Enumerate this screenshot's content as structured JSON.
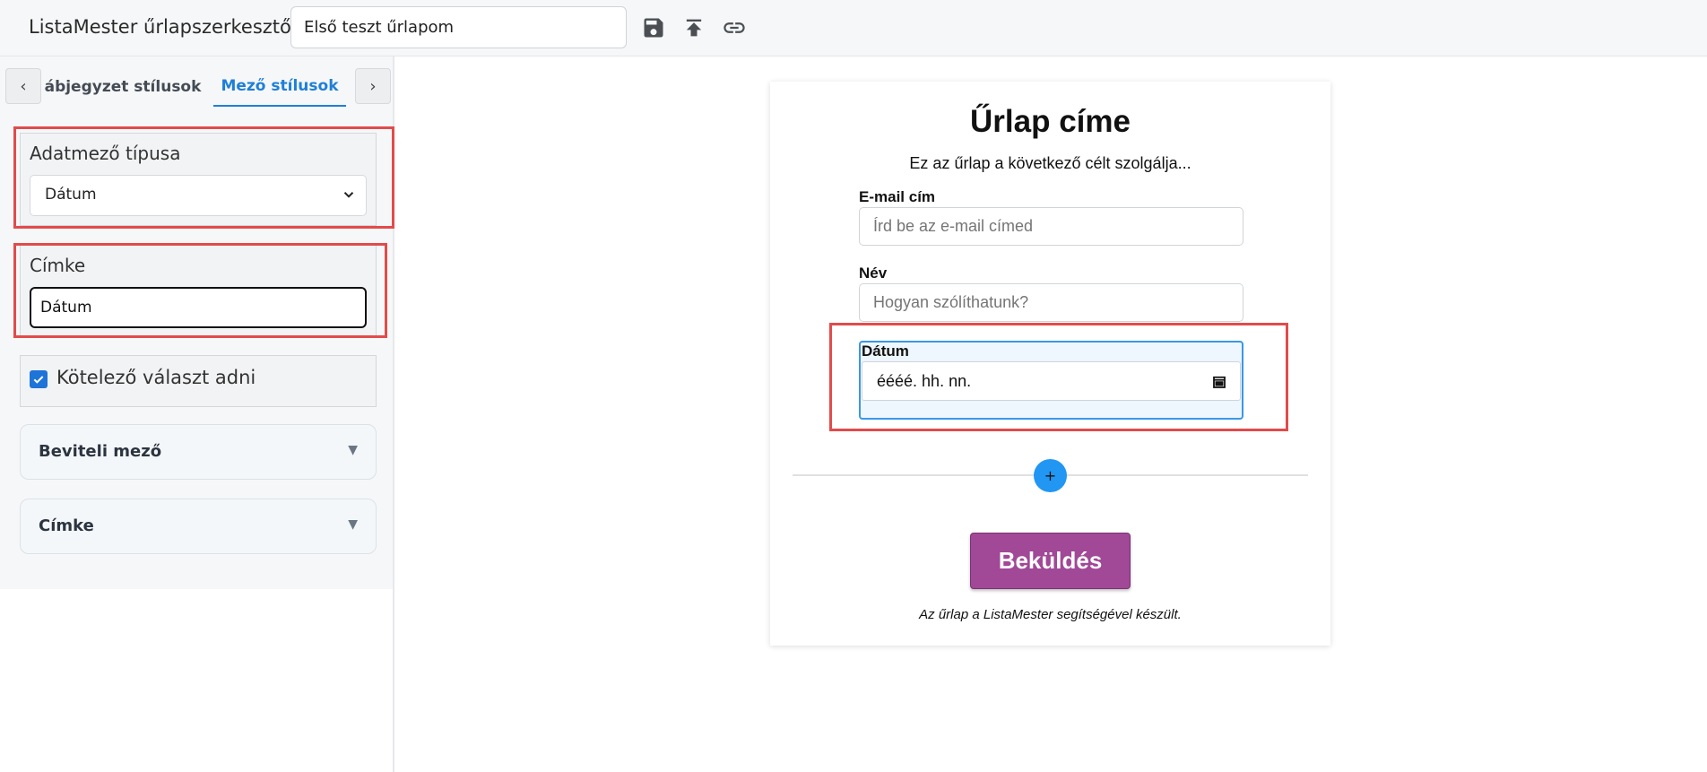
{
  "header": {
    "app_title": "ListaMester űrlapszerkesztő:",
    "form_name_value": "Első teszt űrlapom",
    "icons": [
      "save-icon",
      "upload-icon",
      "link-icon"
    ]
  },
  "sidebar": {
    "tabs": {
      "prev_label": "‹",
      "next_label": "›",
      "truncated_tab": "ábjegyzet stílusok",
      "active_tab": "Mező stílusok"
    },
    "field_type": {
      "label": "Adatmező típusa",
      "selected": "Dátum"
    },
    "label_field": {
      "label": "Címke",
      "value": "Dátum"
    },
    "required": {
      "label": "Kötelező választ adni",
      "checked": true
    },
    "accordions": [
      {
        "label": "Beviteli mező",
        "arrow": "▼"
      },
      {
        "label": "Címke",
        "arrow": "▼"
      }
    ]
  },
  "preview": {
    "title": "Űrlap címe",
    "description": "Ez az űrlap a következő célt szolgálja...",
    "fields": [
      {
        "label": "E-mail cím",
        "placeholder": "Írd be az e-mail címed"
      },
      {
        "label": "Név",
        "placeholder": "Hogyan szólíthatunk?"
      },
      {
        "label": "Dátum",
        "placeholder": "éééé. hh. nn."
      }
    ],
    "add_button": "+",
    "submit_label": "Beküldés",
    "footer": "Az űrlap a ListaMester segítségével készült."
  },
  "colors": {
    "accent_blue": "#1f7fd8",
    "submit_purple": "#a14897",
    "highlight_red": "#e24b4b",
    "add_button_blue": "#2196f3"
  }
}
